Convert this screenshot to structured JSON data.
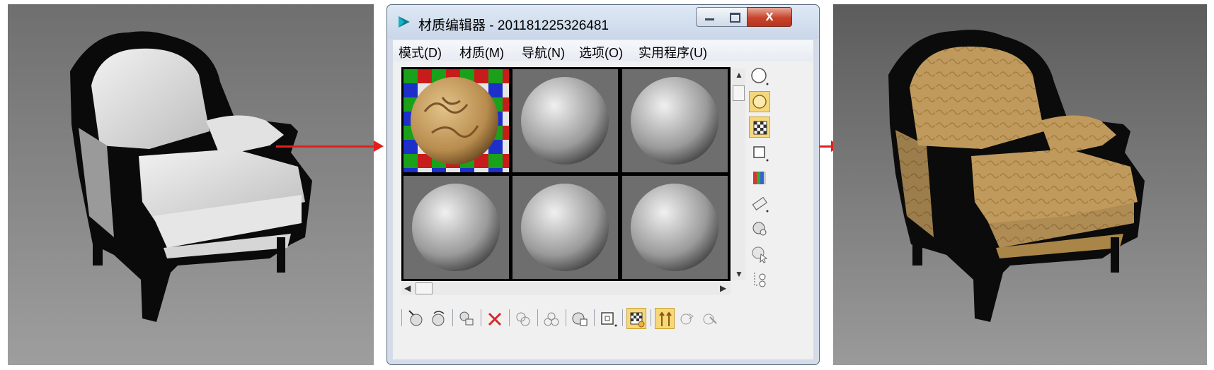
{
  "window": {
    "title": "材质编辑器 - 201181225326481",
    "close_glyph": "x"
  },
  "menu": [
    "模式(D)",
    "材质(M)",
    "导航(N)",
    "选项(O)",
    "实用程序(U)"
  ],
  "slots": [
    {
      "name": "textured-fabric-material",
      "selected": true
    },
    {
      "name": "default-gray",
      "selected": false
    },
    {
      "name": "default-gray",
      "selected": false
    },
    {
      "name": "default-gray",
      "selected": false
    },
    {
      "name": "default-gray",
      "selected": false
    },
    {
      "name": "default-gray",
      "selected": false
    }
  ],
  "side_tools": [
    "sample-type-sphere-icon",
    "backlight-icon",
    "checker-background-icon",
    "sample-uv-tiling-icon",
    "video-color-check-icon",
    "make-preview-icon",
    "options-icon",
    "select-by-material-icon",
    "material-map-navigator-icon"
  ],
  "bottom_tools": [
    "get-material-icon",
    "put-to-scene-icon",
    "assign-to-selection-icon",
    "reset-map-icon",
    "make-unique-icon",
    "put-to-library-icon",
    "material-id-channel-icon",
    "show-shaded-map-icon",
    "show-end-result-icon",
    "go-to-parent-icon",
    "go-forward-to-sibling-icon",
    "go-to-sibling-icon"
  ],
  "colors": {
    "arrow": "#e0201d",
    "selection": "#e02020",
    "fabric": "#c09a5c",
    "frame": "#0b0b0b"
  }
}
